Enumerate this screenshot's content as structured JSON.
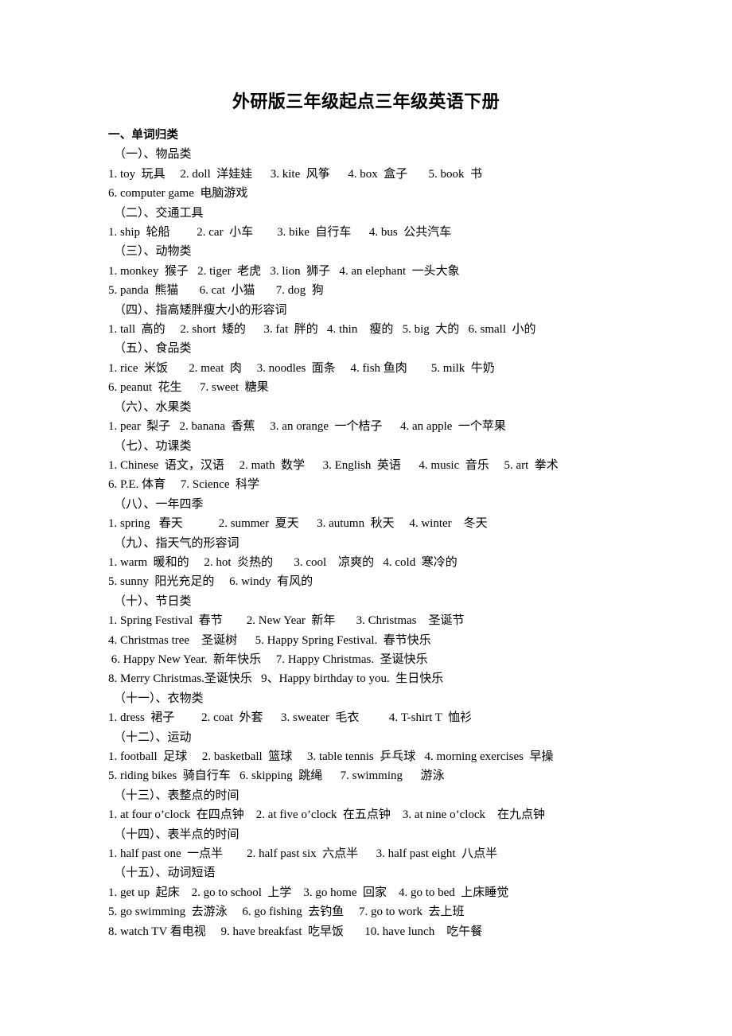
{
  "document": {
    "title": "外研版三年级起点三年级英语下册",
    "section_heading": "一、单词归类",
    "groups": [
      {
        "heading": "（一）、物品类",
        "lines": [
          "1. toy  玩具     2. doll  洋娃娃      3. kite  风筝      4. box  盒子       5. book  书",
          "6. computer game  电脑游戏"
        ]
      },
      {
        "heading": "（二）、交通工具",
        "lines": [
          "1. ship  轮船         2. car  小车        3. bike  自行车      4. bus  公共汽车"
        ]
      },
      {
        "heading": "（三）、动物类",
        "lines": [
          "1. monkey  猴子   2. tiger  老虎   3. lion  狮子   4. an elephant  一头大象",
          "5. panda  熊猫       6. cat  小猫       7. dog  狗"
        ]
      },
      {
        "heading": "（四）、指高矮胖瘦大小的形容词",
        "lines": [
          "1. tall  高的     2. short  矮的      3. fat  胖的   4. thin    瘦的   5. big  大的   6. small  小的"
        ]
      },
      {
        "heading": "（五）、食品类",
        "lines": [
          "1. rice  米饭       2. meat  肉     3. noodles  面条     4. fish 鱼肉        5. milk  牛奶",
          "6. peanut  花生      7. sweet  糖果"
        ]
      },
      {
        "heading": "（六）、水果类",
        "lines": [
          "1. pear  梨子   2. banana  香蕉     3. an orange  一个桔子      4. an apple  一个苹果"
        ]
      },
      {
        "heading": "（七）、功课类",
        "lines": [
          "1. Chinese  语文，汉语     2. math  数学      3. English  英语      4. music  音乐     5. art  拳术",
          "6. P.E. 体育     7. Science  科学"
        ]
      },
      {
        "heading": "（八）、一年四季",
        "lines": [
          "1. spring   春天            2. summer  夏天      3. autumn  秋天     4. winter    冬天"
        ]
      },
      {
        "heading": "（九）、指天气的形容词",
        "lines": [
          "1. warm  暖和的     2. hot  炎热的       3. cool    凉爽的   4. cold  寒冷的",
          "5. sunny  阳光充足的     6. windy  有风的"
        ]
      },
      {
        "heading": "（十）、节日类",
        "lines": [
          "1. Spring Festival  春节        2. New Year  新年       3. Christmas    圣诞节",
          "4. Christmas tree    圣诞树      5. Happy Spring Festival.  春节快乐",
          " 6. Happy New Year.  新年快乐     7. Happy Christmas.  圣诞快乐",
          "8. Merry Christmas.圣诞快乐   9、Happy birthday to you.  生日快乐"
        ]
      },
      {
        "heading": "（十一）、衣物类",
        "lines": [
          "1. dress  裙子         2. coat  外套      3. sweater  毛衣          4. T-shirt T  恤衫"
        ]
      },
      {
        "heading": "（十二）、运动",
        "lines": [
          "1. football  足球     2. basketball  篮球     3. table tennis  乒乓球   4. morning exercises  早操",
          "5. riding bikes  骑自行车   6. skipping  跳绳      7. swimming      游泳"
        ]
      },
      {
        "heading": "（十三）、表整点的时间",
        "lines": [
          "1. at four o’clock  在四点钟    2. at five o’clock  在五点钟    3. at nine o’clock    在九点钟"
        ]
      },
      {
        "heading": "（十四）、表半点的时间",
        "lines": [
          "1. half past one  一点半        2. half past six  六点半      3. half past eight  八点半"
        ]
      },
      {
        "heading": "（十五）、动词短语",
        "lines": [
          "1. get up  起床    2. go to school  上学    3. go home  回家    4. go to bed  上床睡觉",
          "5. go swimming  去游泳     6. go fishing  去钓鱼     7. go to work  去上班",
          "8. watch TV 看电视     9. have breakfast  吃早饭       10. have lunch    吃午餐"
        ]
      }
    ]
  }
}
